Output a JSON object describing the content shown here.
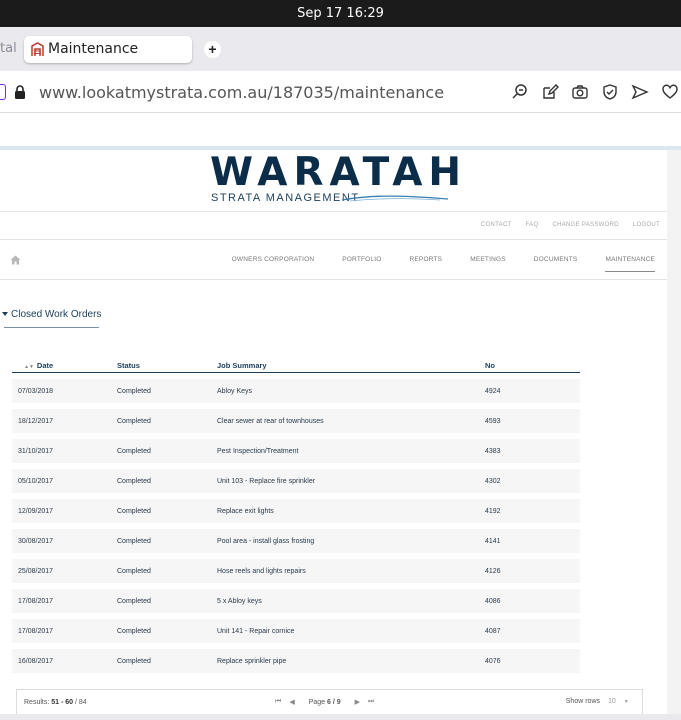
{
  "system": {
    "clock": "Sep 17  16:29"
  },
  "browser": {
    "prev_tab_label": "tal",
    "active_tab_title": "Maintenance",
    "new_tab_label": "+",
    "url_host": "www.lookatmystrata.com.au",
    "url_path": "/187035/maintenance"
  },
  "site": {
    "logo_word": "WARATAH",
    "logo_sub": "STRATA MANAGEMENT",
    "util_nav": [
      "CONTACT",
      "FAQ",
      "CHANGE PASSWORD",
      "LOGOUT"
    ],
    "main_nav": [
      "OWNERS CORPORATION",
      "PORTFOLIO",
      "REPORTS",
      "MEETINGS",
      "DOCUMENTS",
      "MAINTENANCE"
    ],
    "active_nav": "MAINTENANCE"
  },
  "section": {
    "title": "Closed Work Orders"
  },
  "table": {
    "headers": {
      "date": "Date",
      "status": "Status",
      "job": "Job Summary",
      "no": "No"
    },
    "rows": [
      {
        "date": "07/03/2018",
        "status": "Completed",
        "job": "Abloy Keys",
        "no": "4924"
      },
      {
        "date": "18/12/2017",
        "status": "Completed",
        "job": "Clear sewer at rear of townhouses",
        "no": "4593"
      },
      {
        "date": "31/10/2017",
        "status": "Completed",
        "job": "Pest Inspection/Treatment",
        "no": "4383"
      },
      {
        "date": "05/10/2017",
        "status": "Completed",
        "job": "Unit 103 - Replace fire sprinkler",
        "no": "4302"
      },
      {
        "date": "12/09/2017",
        "status": "Completed",
        "job": "Replace exit lights",
        "no": "4192"
      },
      {
        "date": "30/08/2017",
        "status": "Completed",
        "job": "Pool area - install glass frosting",
        "no": "4141"
      },
      {
        "date": "25/08/2017",
        "status": "Completed",
        "job": "Hose reels and lights repairs",
        "no": "4126"
      },
      {
        "date": "17/08/2017",
        "status": "Completed",
        "job": "5 x Abloy keys",
        "no": "4086"
      },
      {
        "date": "17/08/2017",
        "status": "Completed",
        "job": "Unit 141 - Repair cornice",
        "no": "4087"
      },
      {
        "date": "16/08/2017",
        "status": "Completed",
        "job": "Replace sprinkler pipe",
        "no": "4076"
      }
    ]
  },
  "pagination": {
    "results_label": "Results:",
    "results_range": "51 - 60",
    "results_total": "/ 84",
    "page_label": "Page",
    "page_value": "6 / 9",
    "show_rows_label": "Show rows",
    "rows_value": "10"
  },
  "colors": {
    "brand_navy": "#0c2d4a",
    "wave_blue": "#3a7fb0",
    "tab_icon_red": "#c0392b"
  }
}
